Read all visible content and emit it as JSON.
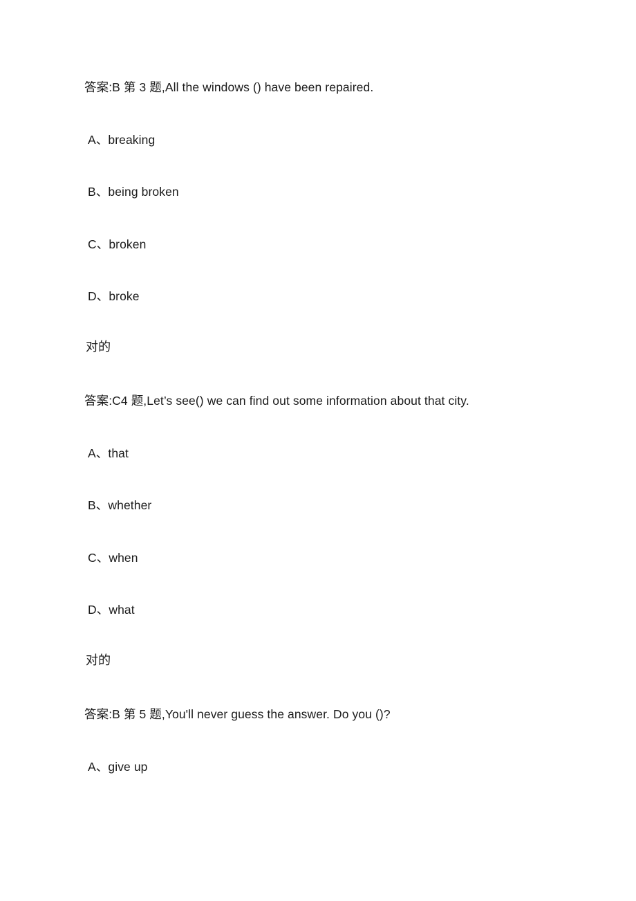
{
  "document": {
    "background_color": "#ffffff",
    "text_color": "#1b1b1b",
    "blocks": [
      {
        "heading": "答案:B 第 3 题,All the windows () have been repaired.",
        "options": [
          {
            "label": "A、",
            "text": "breaking"
          },
          {
            "label": "B、",
            "text": "being broken"
          },
          {
            "label": "C、",
            "text": "broken"
          },
          {
            "label": "D、",
            "text": "broke"
          }
        ],
        "marker": "对的"
      },
      {
        "heading": "答案:C4 题,Let’s see() we can find out some information about that city.",
        "options": [
          {
            "label": "A、",
            "text": "that"
          },
          {
            "label": "B、",
            "text": "whether"
          },
          {
            "label": "C、",
            "text": "when"
          },
          {
            "label": "D、",
            "text": "what"
          }
        ],
        "marker": "对的"
      },
      {
        "heading": "答案:B 第 5 题,You'll never guess the answer. Do you ()?",
        "options": [
          {
            "label": "A、",
            "text": "give up"
          }
        ]
      }
    ]
  }
}
